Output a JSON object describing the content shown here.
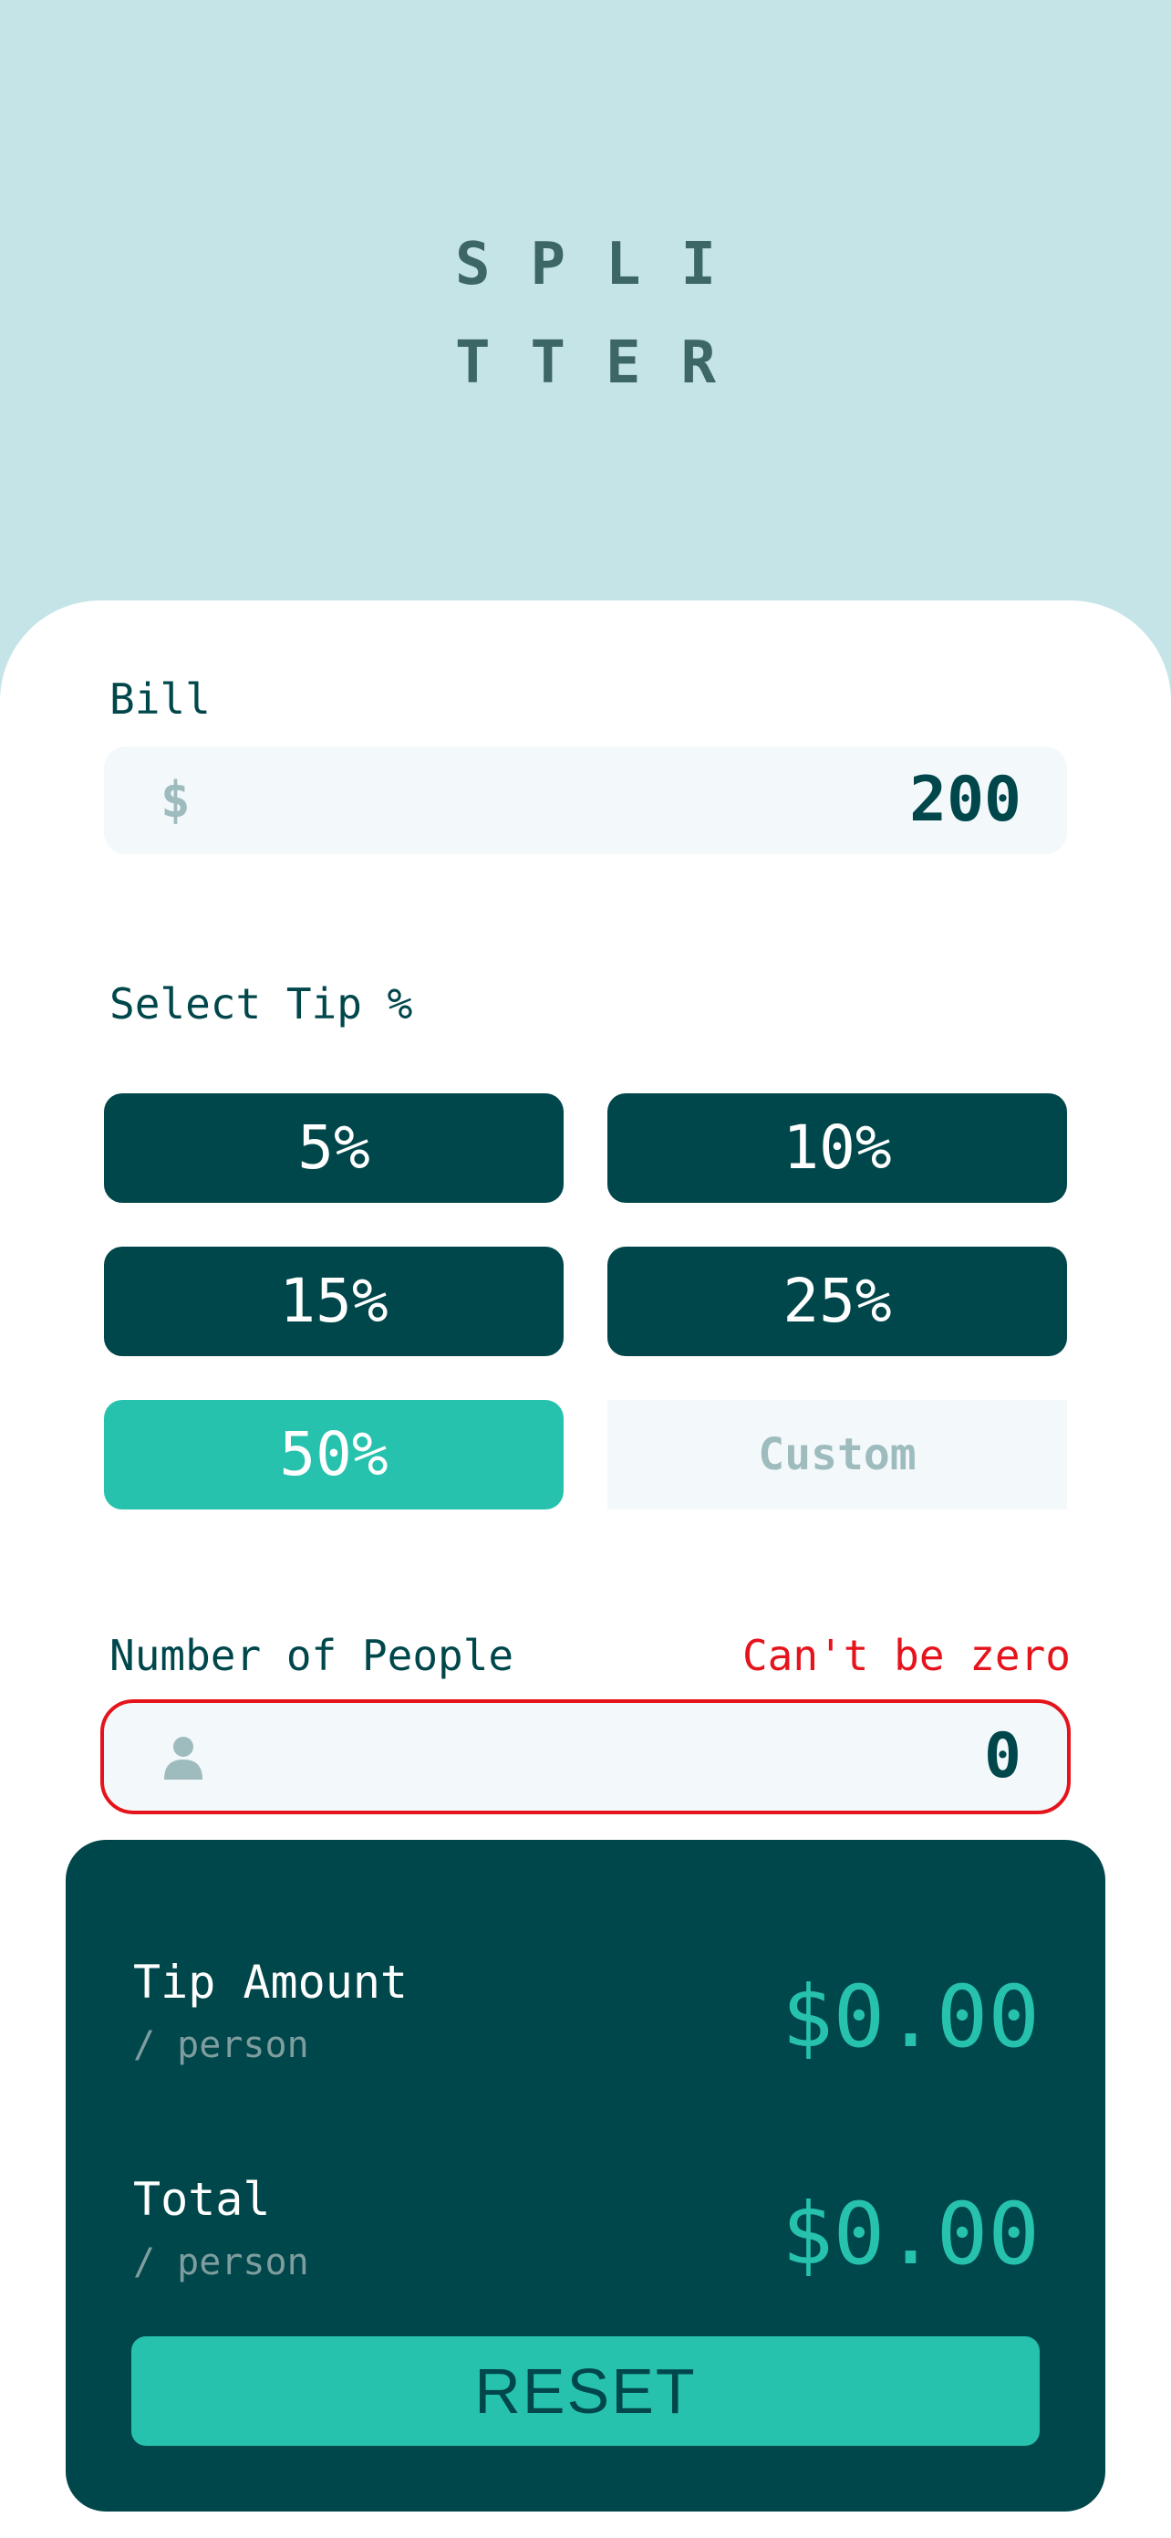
{
  "app": {
    "logo_line1": "SPLI",
    "logo_line2": "TTER"
  },
  "bill": {
    "label": "Bill",
    "currency_symbol": "$",
    "value": "200"
  },
  "tip": {
    "label": "Select Tip %",
    "options": [
      {
        "label": "5%",
        "selected": false
      },
      {
        "label": "10%",
        "selected": false
      },
      {
        "label": "15%",
        "selected": false
      },
      {
        "label": "25%",
        "selected": false
      },
      {
        "label": "50%",
        "selected": true
      }
    ],
    "custom_placeholder": "Custom"
  },
  "people": {
    "label": "Number of People",
    "error": "Can't be zero",
    "icon": "person-icon",
    "value": "0"
  },
  "results": {
    "tip_amount_label": "Tip Amount",
    "tip_amount_sub": "/ person",
    "tip_amount_value": "$0.00",
    "total_label": "Total",
    "total_sub": "/ person",
    "total_value": "$0.00",
    "reset_label": "RESET"
  },
  "colors": {
    "background": "#c5e4e7",
    "dark_cyan": "#00474b",
    "strong_cyan": "#26c2ad",
    "error": "#e5141c",
    "input_bg": "#f3f8fb",
    "muted": "#9ebbbd"
  }
}
